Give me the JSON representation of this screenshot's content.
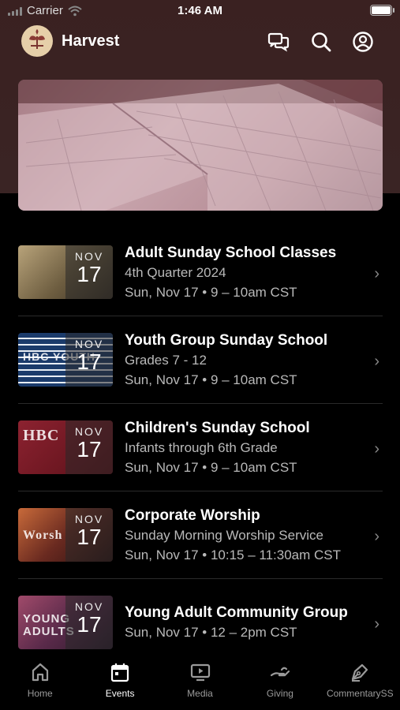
{
  "status_bar": {
    "carrier": "Carrier",
    "time": "1:46 AM"
  },
  "header": {
    "app_name": "Harvest",
    "icons": [
      "chat-icon",
      "search-icon",
      "account-icon"
    ]
  },
  "events": [
    {
      "month": "NOV",
      "day": "17",
      "title": "Adult Sunday School Classes",
      "subtitle": "4th Quarter 2024",
      "when": "Sun, Nov 17 • 9 – 10am CST",
      "thumb_color": "#8a7a5a",
      "thumb_text": ""
    },
    {
      "month": "NOV",
      "day": "17",
      "title": "Youth Group Sunday School",
      "subtitle": "Grades 7 - 12",
      "when": "Sun, Nov 17 • 9 – 10am CST",
      "thumb_color": "#1b3b6b",
      "thumb_text": "HBC YOUTH"
    },
    {
      "month": "NOV",
      "day": "17",
      "title": "Children's Sunday School",
      "subtitle": "Infants through 6th Grade",
      "when": "Sun, Nov 17 • 9 – 10am CST",
      "thumb_color": "#7a1c26",
      "thumb_text": "HBC"
    },
    {
      "month": "NOV",
      "day": "17",
      "title": "Corporate Worship",
      "subtitle": "Sunday Morning Worship Service",
      "when": "Sun, Nov 17 • 10:15 – 11:30am CST",
      "thumb_color": "#6a2a20",
      "thumb_text": "Worsh"
    },
    {
      "month": "NOV",
      "day": "17",
      "title": "Young Adult Community Group",
      "subtitle": "",
      "when": "Sun, Nov 17 • 12 – 2pm CST",
      "thumb_color": "#5a2a4a",
      "thumb_text": "YOUNG ADULTS"
    }
  ],
  "tabs": [
    {
      "label": "Home",
      "icon": "home-icon",
      "active": false
    },
    {
      "label": "Events",
      "icon": "calendar-icon",
      "active": true
    },
    {
      "label": "Media",
      "icon": "play-screen-icon",
      "active": false
    },
    {
      "label": "Giving",
      "icon": "giving-hand-icon",
      "active": false
    },
    {
      "label": "CommentarySS",
      "icon": "pen-nib-icon",
      "active": false
    }
  ]
}
